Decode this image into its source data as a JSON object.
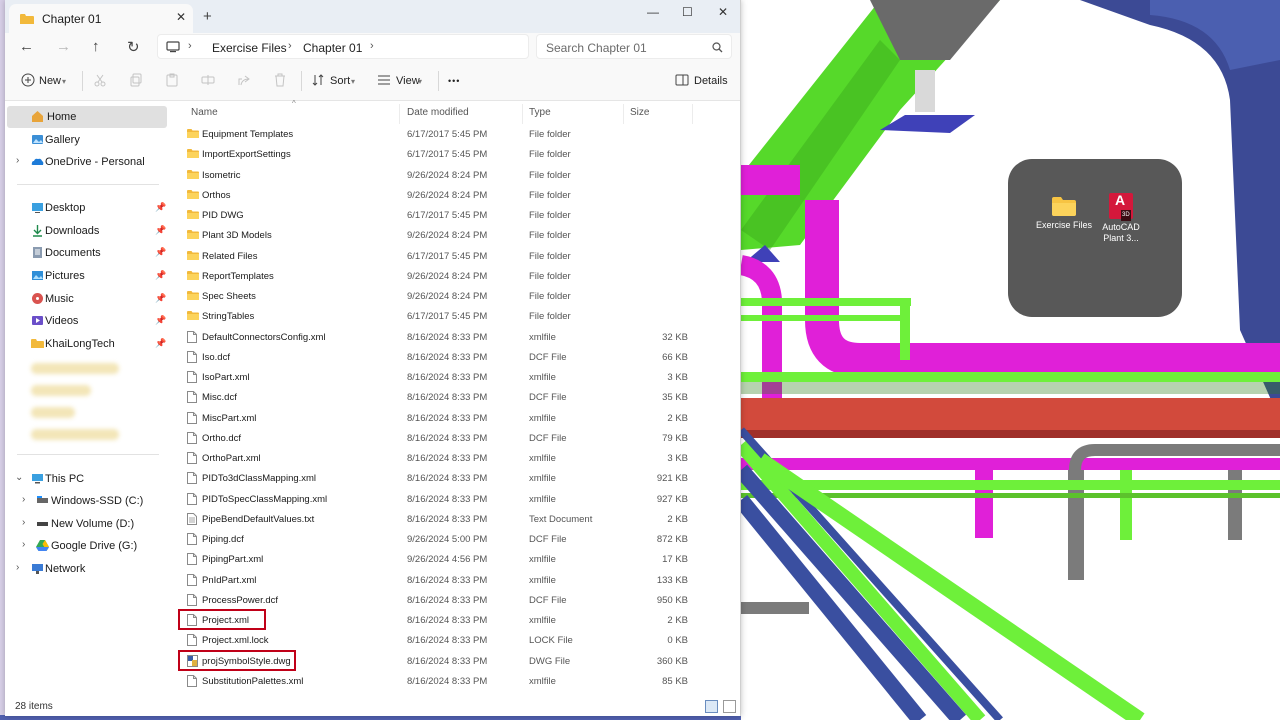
{
  "window": {
    "tab_title": "Chapter 01",
    "tab_close": "✕",
    "new_tab": "+",
    "minimize": "—",
    "maximize": "☐",
    "close": "✕"
  },
  "nav": {
    "back": "←",
    "forward": "→",
    "up": "↑",
    "refresh": "↻"
  },
  "breadcrumb": [
    "Exercise Files",
    "Chapter 01"
  ],
  "breadcrumb_sep": "›",
  "search": {
    "placeholder": "Search Chapter 01"
  },
  "toolbar": {
    "new_label": "New",
    "sort_label": "Sort",
    "view_label": "View",
    "more_label": "•••",
    "details_label": "Details",
    "icons": [
      "cut-icon",
      "copy-icon",
      "paste-icon",
      "rename-icon",
      "share-icon",
      "delete-icon"
    ]
  },
  "sidebar": {
    "home": "Home",
    "gallery": "Gallery",
    "onedrive": "OneDrive - Personal",
    "quick_access": [
      {
        "label": "Desktop",
        "icon": "desktop-icon"
      },
      {
        "label": "Downloads",
        "icon": "download-icon"
      },
      {
        "label": "Documents",
        "icon": "documents-icon"
      },
      {
        "label": "Pictures",
        "icon": "pictures-icon"
      },
      {
        "label": "Music",
        "icon": "music-icon"
      },
      {
        "label": "Videos",
        "icon": "videos-icon"
      },
      {
        "label": "KhaiLongTech",
        "icon": "folder-icon"
      }
    ],
    "this_pc": "This PC",
    "drives": [
      {
        "label": "Windows-SSD (C:)",
        "icon": "drive-icon"
      },
      {
        "label": "New Volume (D:)",
        "icon": "drive-icon"
      },
      {
        "label": "Google Drive (G:)",
        "icon": "google-drive-icon"
      }
    ],
    "network": "Network"
  },
  "columns": {
    "name": "Name",
    "date": "Date modified",
    "type": "Type",
    "size": "Size"
  },
  "files": [
    {
      "name": "Equipment Templates",
      "date": "6/17/2017 5:45 PM",
      "type": "File folder",
      "size": "",
      "kind": "folder"
    },
    {
      "name": "ImportExportSettings",
      "date": "6/17/2017 5:45 PM",
      "type": "File folder",
      "size": "",
      "kind": "folder"
    },
    {
      "name": "Isometric",
      "date": "9/26/2024 8:24 PM",
      "type": "File folder",
      "size": "",
      "kind": "folder"
    },
    {
      "name": "Orthos",
      "date": "9/26/2024 8:24 PM",
      "type": "File folder",
      "size": "",
      "kind": "folder"
    },
    {
      "name": "PID DWG",
      "date": "6/17/2017 5:45 PM",
      "type": "File folder",
      "size": "",
      "kind": "folder"
    },
    {
      "name": "Plant 3D Models",
      "date": "9/26/2024 8:24 PM",
      "type": "File folder",
      "size": "",
      "kind": "folder"
    },
    {
      "name": "Related Files",
      "date": "6/17/2017 5:45 PM",
      "type": "File folder",
      "size": "",
      "kind": "folder"
    },
    {
      "name": "ReportTemplates",
      "date": "9/26/2024 8:24 PM",
      "type": "File folder",
      "size": "",
      "kind": "folder"
    },
    {
      "name": "Spec Sheets",
      "date": "9/26/2024 8:24 PM",
      "type": "File folder",
      "size": "",
      "kind": "folder"
    },
    {
      "name": "StringTables",
      "date": "6/17/2017 5:45 PM",
      "type": "File folder",
      "size": "",
      "kind": "folder"
    },
    {
      "name": "DefaultConnectorsConfig.xml",
      "date": "8/16/2024 8:33 PM",
      "type": "xmlfile",
      "size": "32 KB",
      "kind": "file"
    },
    {
      "name": "Iso.dcf",
      "date": "8/16/2024 8:33 PM",
      "type": "DCF File",
      "size": "66 KB",
      "kind": "file"
    },
    {
      "name": "IsoPart.xml",
      "date": "8/16/2024 8:33 PM",
      "type": "xmlfile",
      "size": "3 KB",
      "kind": "file"
    },
    {
      "name": "Misc.dcf",
      "date": "8/16/2024 8:33 PM",
      "type": "DCF File",
      "size": "35 KB",
      "kind": "file"
    },
    {
      "name": "MiscPart.xml",
      "date": "8/16/2024 8:33 PM",
      "type": "xmlfile",
      "size": "2 KB",
      "kind": "file"
    },
    {
      "name": "Ortho.dcf",
      "date": "8/16/2024 8:33 PM",
      "type": "DCF File",
      "size": "79 KB",
      "kind": "file"
    },
    {
      "name": "OrthoPart.xml",
      "date": "8/16/2024 8:33 PM",
      "type": "xmlfile",
      "size": "3 KB",
      "kind": "file"
    },
    {
      "name": "PIDTo3dClassMapping.xml",
      "date": "8/16/2024 8:33 PM",
      "type": "xmlfile",
      "size": "921 KB",
      "kind": "file"
    },
    {
      "name": "PIDToSpecClassMapping.xml",
      "date": "8/16/2024 8:33 PM",
      "type": "xmlfile",
      "size": "927 KB",
      "kind": "file"
    },
    {
      "name": "PipeBendDefaultValues.txt",
      "date": "8/16/2024 8:33 PM",
      "type": "Text Document",
      "size": "2 KB",
      "kind": "text"
    },
    {
      "name": "Piping.dcf",
      "date": "9/26/2024 5:00 PM",
      "type": "DCF File",
      "size": "872 KB",
      "kind": "file"
    },
    {
      "name": "PipingPart.xml",
      "date": "9/26/2024 4:56 PM",
      "type": "xmlfile",
      "size": "17 KB",
      "kind": "file"
    },
    {
      "name": "PnIdPart.xml",
      "date": "8/16/2024 8:33 PM",
      "type": "xmlfile",
      "size": "133 KB",
      "kind": "file"
    },
    {
      "name": "ProcessPower.dcf",
      "date": "8/16/2024 8:33 PM",
      "type": "DCF File",
      "size": "950 KB",
      "kind": "file"
    },
    {
      "name": "Project.xml",
      "date": "8/16/2024 8:33 PM",
      "type": "xmlfile",
      "size": "2 KB",
      "kind": "file",
      "highlight": true
    },
    {
      "name": "Project.xml.lock",
      "date": "8/16/2024 8:33 PM",
      "type": "LOCK File",
      "size": "0 KB",
      "kind": "file"
    },
    {
      "name": "projSymbolStyle.dwg",
      "date": "8/16/2024 8:33 PM",
      "type": "DWG File",
      "size": "360 KB",
      "kind": "dwg",
      "highlight": true
    },
    {
      "name": "SubstitutionPalettes.xml",
      "date": "8/16/2024 8:33 PM",
      "type": "xmlfile",
      "size": "85 KB",
      "kind": "file"
    }
  ],
  "status": {
    "item_count": "28 items"
  },
  "desktop_popup": {
    "items": [
      {
        "label": "Exercise Files",
        "icon": "folder-icon"
      },
      {
        "label": "AutoCAD\nPlant 3...",
        "icon": "autocad-plant3d-icon",
        "badge": "A",
        "sub_badge": "3D"
      }
    ]
  },
  "colors": {
    "highlight_border": "#c00018",
    "pipe_green": "#6ef03a",
    "pipe_magenta": "#e020d8",
    "pipe_blue": "#3a4fa0",
    "pipe_red": "#d24a3c"
  }
}
